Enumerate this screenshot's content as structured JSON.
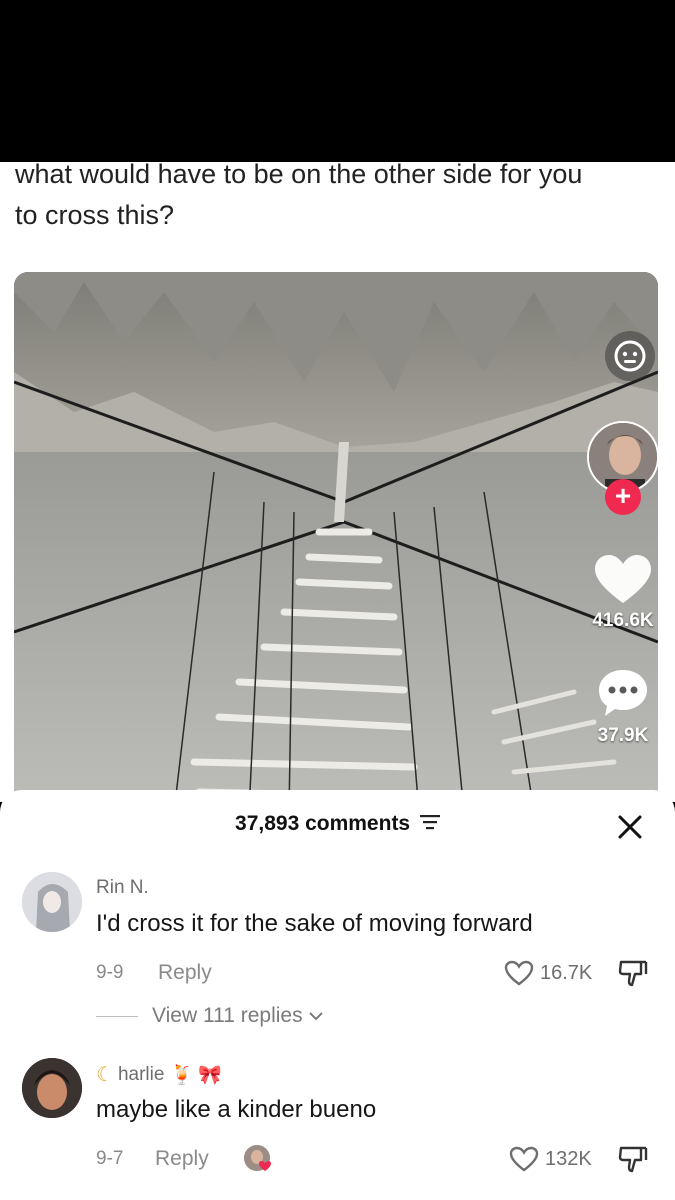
{
  "post": {
    "caption_line1": "what would have to be on the other side for you",
    "caption_line2": "to cross this?"
  },
  "rail": {
    "like_count": "416.6K",
    "comment_count": "37.9K"
  },
  "comments_sheet": {
    "count_label": "37,893 comments",
    "comments": [
      {
        "username": "Rin N.",
        "text": "I'd cross it for the sake of moving forward",
        "date": "9-9",
        "reply_label": "Reply",
        "likes": "16.7K",
        "view_replies": "View 111 replies"
      },
      {
        "username": "harlie",
        "text": "maybe like a kinder bueno",
        "date": "9-7",
        "reply_label": "Reply",
        "likes": "132K"
      }
    ]
  },
  "colors": {
    "accent_red": "#ef2950",
    "text_primary": "#161616",
    "text_secondary": "#8a8a8a"
  }
}
